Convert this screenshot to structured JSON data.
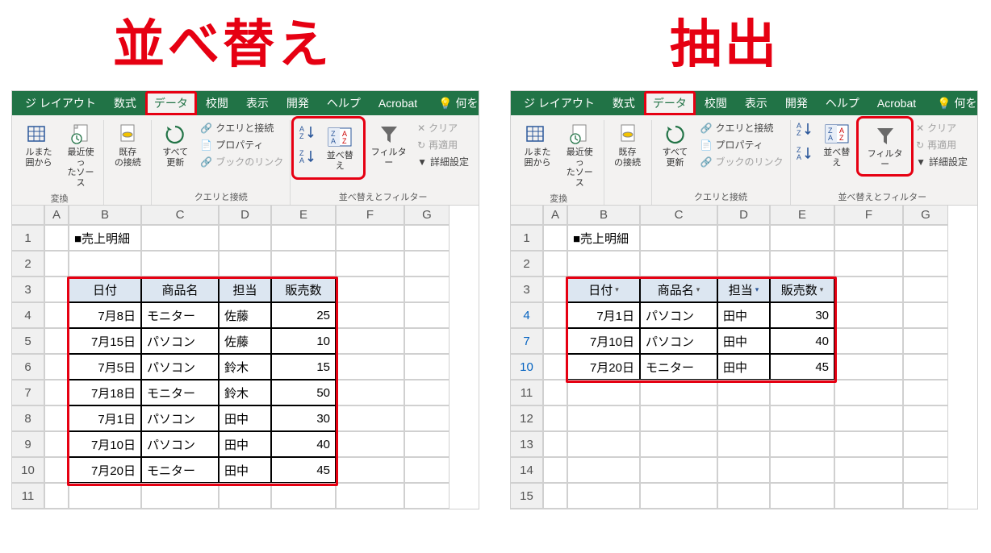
{
  "annotations": {
    "left_title": "並べ替え",
    "right_title": "抽出"
  },
  "ribbon_tabs": {
    "layout": "ジ レイアウト",
    "formulas": "数式",
    "data": "データ",
    "review": "校閲",
    "view": "表示",
    "developer": "開発",
    "help": "ヘルプ",
    "acrobat": "Acrobat",
    "tellme": "何を"
  },
  "ribbon": {
    "transform": "変換",
    "from_range": "ルまた\n囲から",
    "recent_sources": "最近使っ\nたソース",
    "existing_conn": "既存\nの接続",
    "refresh_all": "すべて\n更新",
    "queries_connections": "クエリと接続",
    "properties": "プロパティ",
    "book_link": "ブックのリンク",
    "queries_group": "クエリと接続",
    "sort": "並べ替え",
    "filter": "フィルター",
    "clear": "クリア",
    "reapply": "再適用",
    "advanced": "詳細設定",
    "sort_filter_group": "並べ替えとフィルター"
  },
  "grid_headers": [
    "A",
    "B",
    "C",
    "D",
    "E",
    "F",
    "G"
  ],
  "left_sheet": {
    "title": "■売上明細",
    "row_numbers": [
      "1",
      "2",
      "3",
      "4",
      "5",
      "6",
      "7",
      "8",
      "9",
      "10",
      "11"
    ],
    "col_headers": [
      "日付",
      "商品名",
      "担当",
      "販売数"
    ],
    "rows": [
      {
        "date": "7月8日",
        "prod": "モニター",
        "person": "佐藤",
        "qty": "25"
      },
      {
        "date": "7月15日",
        "prod": "パソコン",
        "person": "佐藤",
        "qty": "10"
      },
      {
        "date": "7月5日",
        "prod": "パソコン",
        "person": "鈴木",
        "qty": "15"
      },
      {
        "date": "7月18日",
        "prod": "モニター",
        "person": "鈴木",
        "qty": "50"
      },
      {
        "date": "7月1日",
        "prod": "パソコン",
        "person": "田中",
        "qty": "30"
      },
      {
        "date": "7月10日",
        "prod": "パソコン",
        "person": "田中",
        "qty": "40"
      },
      {
        "date": "7月20日",
        "prod": "モニター",
        "person": "田中",
        "qty": "45"
      }
    ]
  },
  "right_sheet": {
    "title": "■売上明細",
    "row_numbers": [
      "1",
      "2",
      "3",
      "4",
      "7",
      "10",
      "11",
      "12",
      "13",
      "14",
      "15"
    ],
    "blue_rows": [
      "4",
      "7",
      "10"
    ],
    "col_headers": [
      "日付",
      "商品名",
      "担当",
      "販売数"
    ],
    "rows": [
      {
        "date": "7月1日",
        "prod": "パソコン",
        "person": "田中",
        "qty": "30"
      },
      {
        "date": "7月10日",
        "prod": "パソコン",
        "person": "田中",
        "qty": "40"
      },
      {
        "date": "7月20日",
        "prod": "モニター",
        "person": "田中",
        "qty": "45"
      }
    ]
  }
}
